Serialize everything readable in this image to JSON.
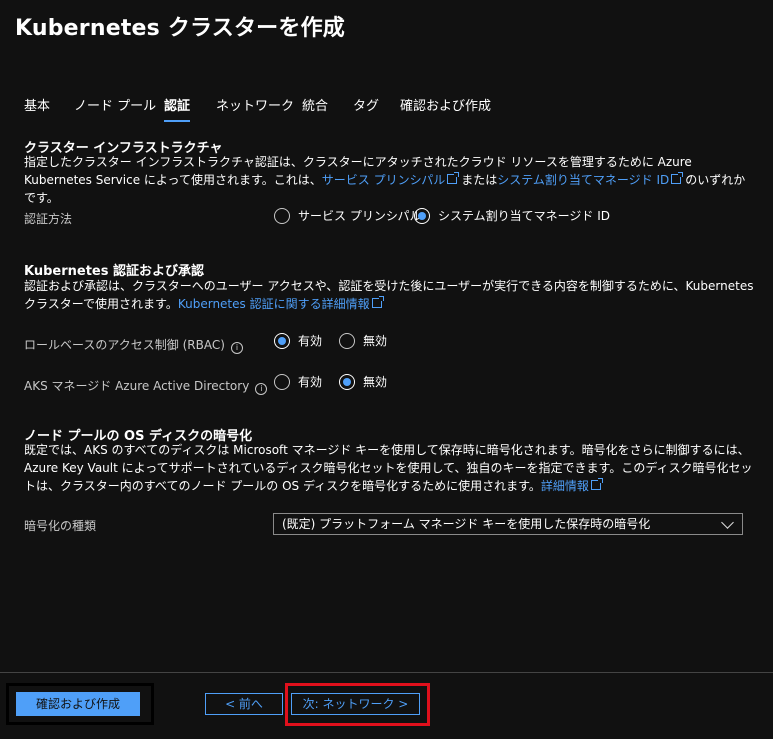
{
  "header": {
    "title": "Kubernetes クラスターを作成"
  },
  "tabs": [
    {
      "label": "基本"
    },
    {
      "label": "ノード プール"
    },
    {
      "label": "認証"
    },
    {
      "label": "ネットワーク"
    },
    {
      "label": "統合"
    },
    {
      "label": "タグ"
    },
    {
      "label": "確認および作成"
    }
  ],
  "infra": {
    "title": "クラスター インフラストラクチャ",
    "desc_part1": "指定したクラスター インフラストラクチャ認証は、クラスターにアタッチされたクラウド リソースを管理するために Azure Kubernetes Service によって使用されます。これは、",
    "link1": "サービス プリンシパル",
    "desc_part2": "または",
    "link2": "システム割り当てマネージド ID",
    "desc_part3": "のいずれかです。",
    "method_label": "認証方法",
    "options": [
      "サービス プリンシパル",
      "システム割り当てマネージド ID"
    ]
  },
  "k8s_auth": {
    "title": "Kubernetes 認証および承認",
    "desc": "認証および承認は、クラスターへのユーザー アクセスや、認証を受けた後にユーザーが実行できる内容を制御するために、Kubernetes クラスターで使用されます。",
    "link": "Kubernetes 認証に関する詳細情報",
    "rbac_label": "ロールベースのアクセス制御 (RBAC)",
    "aad_label": "AKS マネージド Azure Active Directory",
    "enabled": "有効",
    "disabled": "無効"
  },
  "encryption": {
    "title": "ノード プールの OS ディスクの暗号化",
    "desc": "既定では、AKS のすべてのディスクは Microsoft マネージド キーを使用して保存時に暗号化されます。暗号化をさらに制御するには、Azure Key Vault によってサポートされているディスク暗号化セットを使用して、独自のキーを指定できます。このディスク暗号化セットは、クラスター内のすべてのノード プールの OS ディスクを暗号化するために使用されます。",
    "link": "詳細情報",
    "type_label": "暗号化の種類",
    "selected": "(既定) プラットフォーム マネージド キーを使用した保存時の暗号化"
  },
  "footer": {
    "review_create": "確認および作成",
    "prev": "< 前へ",
    "next": "次: ネットワーク >"
  },
  "colors": {
    "accent": "#4f9ff8",
    "highlight": "#e0101c",
    "background": "#111111"
  }
}
